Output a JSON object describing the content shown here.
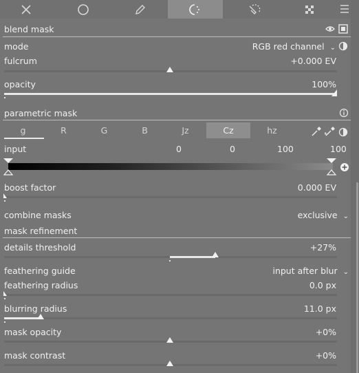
{
  "module_tabs": [
    {
      "icon": "close-icon",
      "active": false
    },
    {
      "icon": "circle-icon",
      "active": false
    },
    {
      "icon": "pencil-icon",
      "active": false
    },
    {
      "icon": "parametric-mask-icon",
      "active": true
    },
    {
      "icon": "drawn-parametric-icon",
      "active": false
    },
    {
      "icon": "raster-mask-icon",
      "active": false
    }
  ],
  "menu_icon": "hamburger-menu-icon",
  "blend_mask": {
    "title": "blend mask"
  },
  "mode": {
    "label": "mode",
    "value": "RGB red channel"
  },
  "fulcrum": {
    "label": "fulcrum",
    "value": "+0.000 EV",
    "position": 0.5
  },
  "opacity": {
    "label": "opacity",
    "value": "100%",
    "level": 1.0
  },
  "parametric_mask": {
    "title": "parametric mask"
  },
  "channels": [
    {
      "label": "g",
      "active": false,
      "underline": true
    },
    {
      "label": "R",
      "active": false
    },
    {
      "label": "G",
      "active": false
    },
    {
      "label": "B",
      "active": false
    },
    {
      "label": "Jz",
      "active": false
    },
    {
      "label": "Cz",
      "active": true
    },
    {
      "label": "hz",
      "active": false
    }
  ],
  "input": {
    "label": "input",
    "values": [
      "0",
      "0",
      "100",
      "100"
    ]
  },
  "boost_factor": {
    "label": "boost factor",
    "value": "0.000 EV",
    "level": 0.0
  },
  "combine_masks": {
    "label": "combine masks",
    "value": "exclusive"
  },
  "mask_refinement": {
    "title": "mask refinement"
  },
  "details_threshold": {
    "label": "details threshold",
    "value": "+27%",
    "level": 0.635
  },
  "feathering_guide": {
    "label": "feathering guide",
    "value": "input after blur"
  },
  "feathering_radius": {
    "label": "feathering radius",
    "value": "0.0 px",
    "level": 0.0
  },
  "blurring_radius": {
    "label": "blurring radius",
    "value": "11.0 px",
    "level": 0.11
  },
  "mask_opacity": {
    "label": "mask opacity",
    "value": "+0%",
    "position": 0.5
  },
  "mask_contrast": {
    "label": "mask contrast",
    "value": "+0%",
    "position": 0.5
  }
}
